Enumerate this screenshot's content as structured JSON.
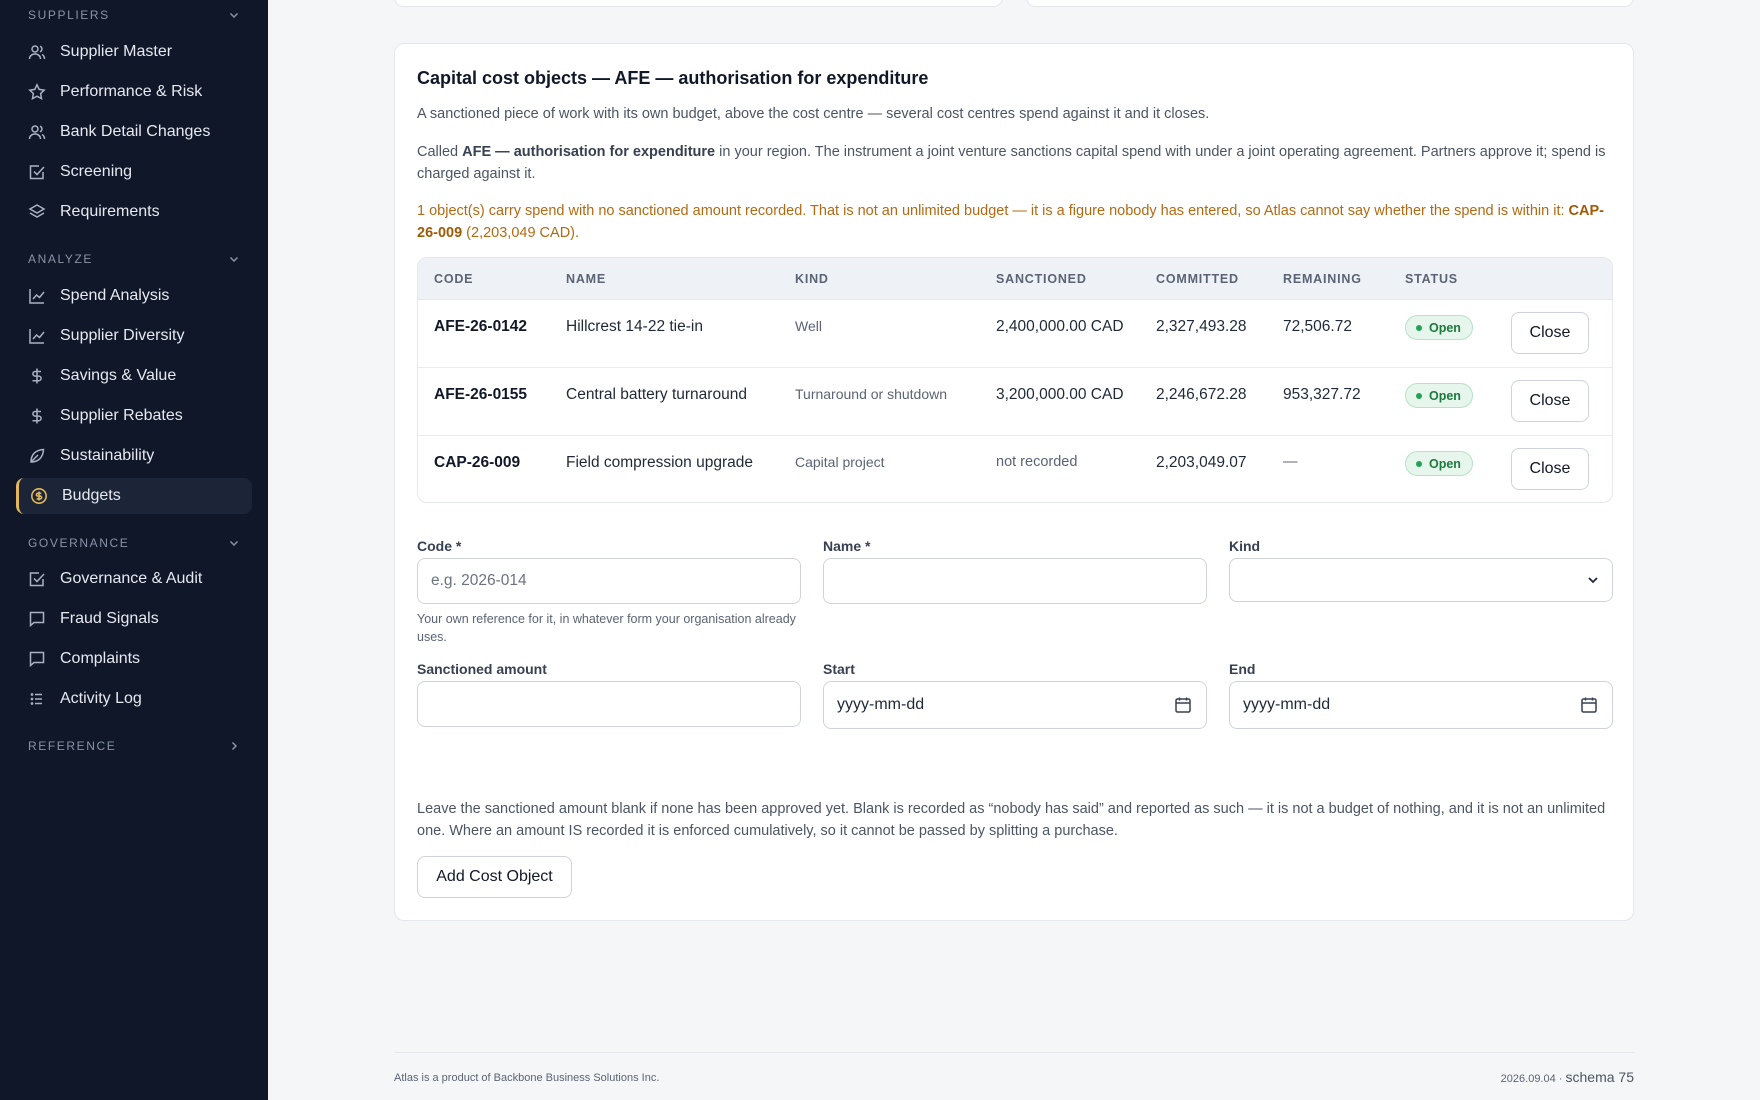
{
  "sidebar": {
    "sections": [
      {
        "title": "SUPPLIERS",
        "items": [
          "Supplier Master",
          "Performance & Risk",
          "Bank Detail Changes",
          "Screening",
          "Requirements"
        ]
      },
      {
        "title": "ANALYZE",
        "items": [
          "Spend Analysis",
          "Supplier Diversity",
          "Savings & Value",
          "Supplier Rebates",
          "Sustainability",
          "Budgets"
        ]
      },
      {
        "title": "GOVERNANCE",
        "items": [
          "Governance & Audit",
          "Fraud Signals",
          "Complaints",
          "Activity Log"
        ]
      },
      {
        "title": "REFERENCE",
        "items": []
      }
    ],
    "active_item": "Budgets"
  },
  "card": {
    "title": "Capital cost objects — AFE — authorisation for expenditure",
    "intro": "A sanctioned piece of work with its own budget, above the cost centre — several cost centres spend against it and it closes.",
    "called_pre": "Called ",
    "called_term": "AFE — authorisation for expenditure",
    "called_post": " in your region. The instrument a joint venture sanctions capital spend with under a joint operating agreement. Partners approve it; spend is charged against it.",
    "warning_pre": "1 object(s) carry spend with no sanctioned amount recorded. That is not an unlimited budget — it is a figure nobody has entered, so Atlas cannot say whether the spend is within it: ",
    "warning_code": "CAP-26-009",
    "warning_post": " (2,203,049 CAD).",
    "table": {
      "headers": [
        "CODE",
        "NAME",
        "KIND",
        "SANCTIONED",
        "COMMITTED",
        "REMAINING",
        "STATUS"
      ],
      "rows": [
        {
          "code": "AFE-26-0142",
          "name": "Hillcrest 14-22 tie-in",
          "kind": "Well",
          "sanctioned": "2,400,000.00 CAD",
          "committed": "2,327,493.28",
          "remaining": "72,506.72",
          "status": "Open",
          "action": "Close"
        },
        {
          "code": "AFE-26-0155",
          "name": "Central battery turnaround",
          "kind": "Turnaround or shutdown",
          "sanctioned": "3,200,000.00 CAD",
          "committed": "2,246,672.28",
          "remaining": "953,327.72",
          "status": "Open",
          "action": "Close"
        },
        {
          "code": "CAP-26-009",
          "name": "Field compression upgrade",
          "kind": "Capital project",
          "sanctioned": "not recorded",
          "committed": "2,203,049.07",
          "remaining": "—",
          "status": "Open",
          "action": "Close"
        }
      ]
    },
    "form": {
      "code_label": "Code *",
      "code_placeholder": "e.g. 2026-014",
      "code_hint": "Your own reference for it, in whatever form your organisation already uses.",
      "name_label": "Name *",
      "kind_label": "Kind",
      "amount_label": "Sanctioned amount",
      "start_label": "Start",
      "start_placeholder": "yyyy-mm-dd",
      "end_label": "End",
      "end_placeholder": "yyyy-mm-dd",
      "note": "Leave the sanctioned amount blank if none has been approved yet. Blank is recorded as “nobody has said” and reported as such — it is not a budget of nothing, and it is not an unlimited one. Where an amount IS recorded it is enforced cumulatively, so it cannot be passed by splitting a purchase.",
      "submit_label": "Add Cost Object"
    }
  },
  "footer": {
    "left": "Atlas is a product of Backbone Business Solutions Inc.",
    "version": "2026.09.04 · ",
    "schema": "schema 75"
  },
  "colors": {
    "sidebar_bg": "#0f1729",
    "accent": "#e1b75a",
    "warning": "#b26a12",
    "badge_green": "#1d7a3e"
  }
}
